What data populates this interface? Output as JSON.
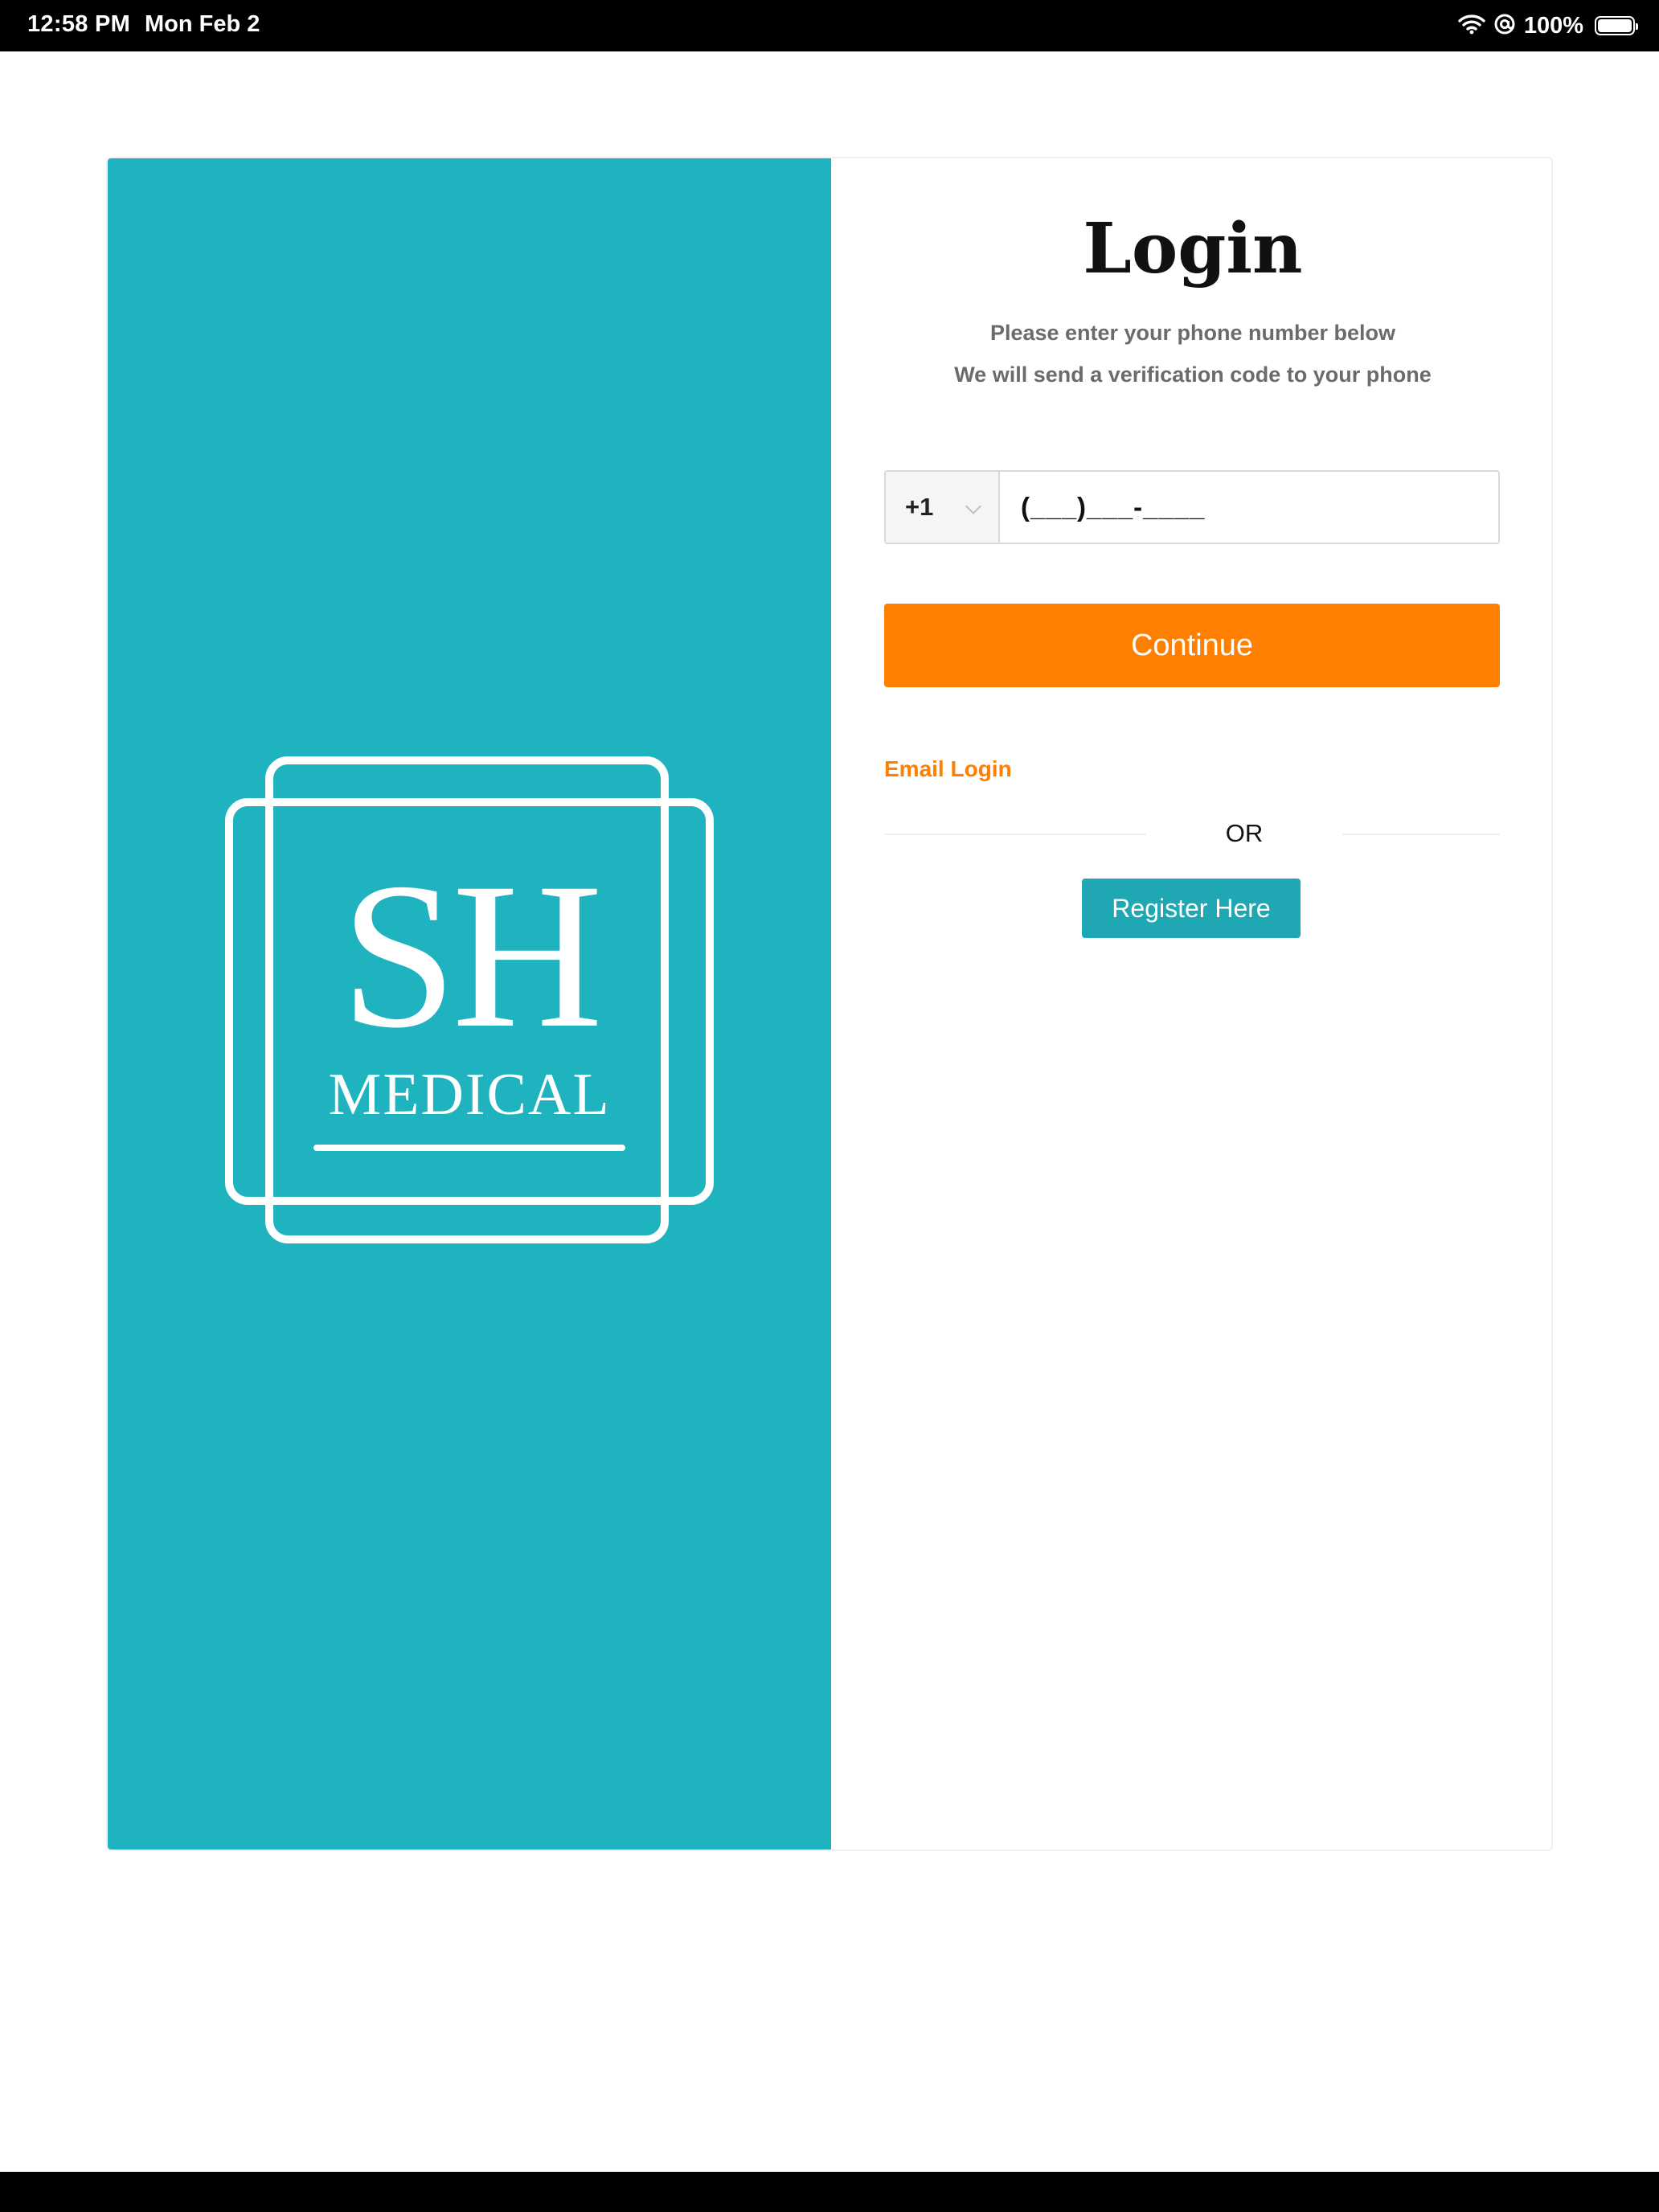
{
  "status_bar": {
    "time": "12:58 PM",
    "date": "Mon Feb 2",
    "battery_percent": "100%",
    "icons": [
      "wifi-icon",
      "at-sign-icon",
      "battery-icon"
    ]
  },
  "brand": {
    "logo_primary": "SH",
    "logo_secondary": "MEDICAL",
    "background_color": "#1fb2bf"
  },
  "login": {
    "title": "Login",
    "subtitle_line1": "Please enter your phone number below",
    "subtitle_line2": "We will send a verification code to your phone",
    "country_code": "+1",
    "phone_placeholder": "(___)___-____",
    "continue_label": "Continue",
    "email_login_label": "Email Login",
    "or_label": "OR",
    "register_label": "Register Here"
  },
  "colors": {
    "accent_orange": "#ff7f00",
    "teal": "#1fa8b3"
  }
}
